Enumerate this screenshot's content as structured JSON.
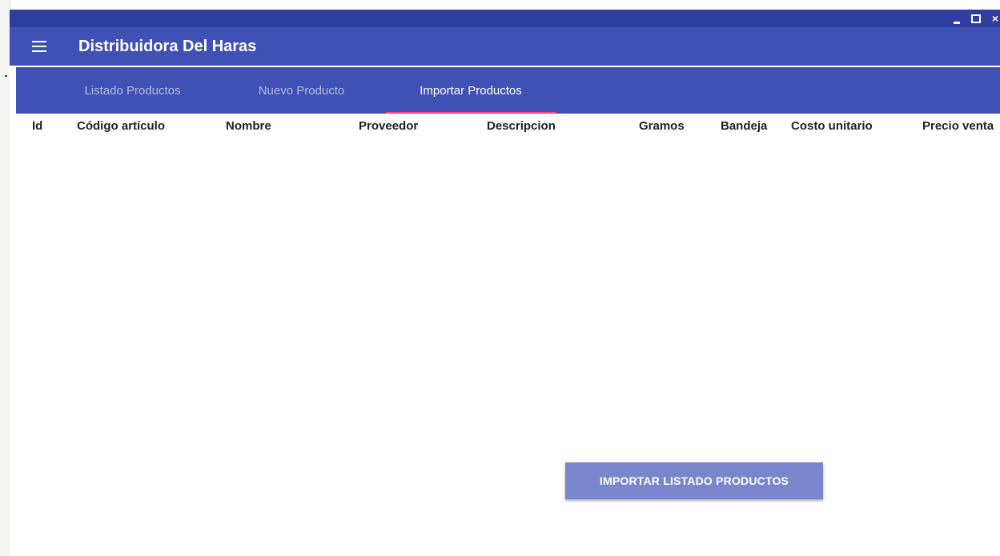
{
  "window": {
    "minimize_glyph": "_",
    "maximize_glyph": "□",
    "close_glyph": "×"
  },
  "appbar": {
    "title": "Distribuidora Del Haras",
    "menu_icon": "hamburger-menu-icon"
  },
  "tabs": [
    {
      "label": "Listado Productos",
      "active": false
    },
    {
      "label": "Nuevo Producto",
      "active": false
    },
    {
      "label": "Importar Productos",
      "active": true
    }
  ],
  "table": {
    "columns": [
      "Id",
      "Código artículo",
      "Nombre",
      "Proveedor",
      "Descripcion",
      "Gramos",
      "Bandeja",
      "Costo unitario",
      "Precio venta"
    ],
    "rows": []
  },
  "import_button": {
    "label": "IMPORTAR LISTADO PRODUCTOS"
  },
  "colors": {
    "primary": "#3f51b5",
    "primary_dark": "#303f9f",
    "accent": "#ff4081",
    "button": "#7986cb"
  }
}
